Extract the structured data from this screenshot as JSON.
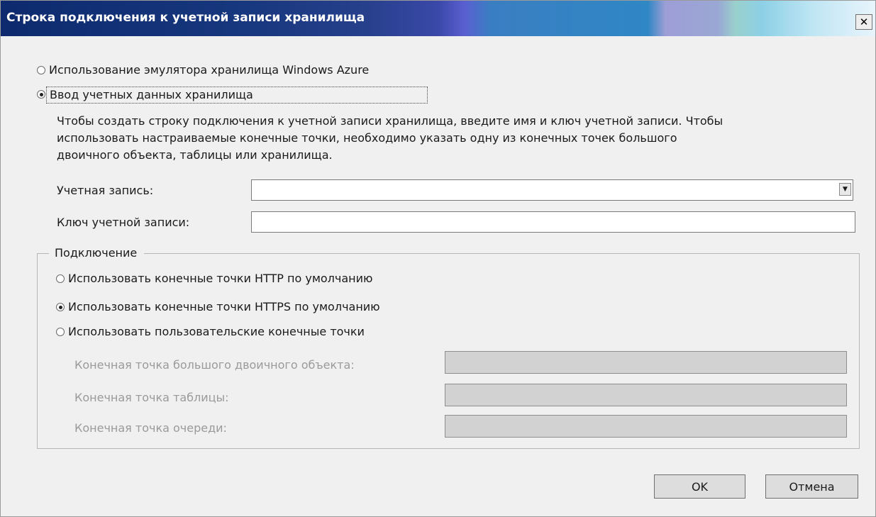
{
  "window": {
    "title": "Строка подключения к учетной записи хранилища",
    "close_glyph": "✕"
  },
  "storage_mode": {
    "emulator_label": "Использование эмулятора хранилища Windows Azure",
    "credentials_label": "Ввод учетных данных хранилища",
    "selected": "credentials"
  },
  "description": [
    "Чтобы создать строку подключения к учетной записи хранилища, введите имя и ключ учетной записи.  Чтобы",
    "использовать настраиваемые конечные точки, необходимо указать одну из конечных точек большого",
    "двоичного объекта, таблицы или хранилища."
  ],
  "account": {
    "name_label": "Учетная запись:",
    "name_value": "",
    "key_label": "Ключ учетной записи:",
    "key_value": "",
    "dropdown_glyph": "▼"
  },
  "connection": {
    "group_label": "Подключение",
    "http_label": "Использовать конечные точки HTTP по умолчанию",
    "https_label": "Использовать конечные точки HTTPS по умолчанию",
    "custom_label": "Использовать пользовательские конечные точки",
    "selected": "https",
    "blob_endpoint_label": "Конечная точка большого двоичного объекта:",
    "table_endpoint_label": "Конечная точка таблицы:",
    "queue_endpoint_label": "Конечная точка очереди:"
  },
  "buttons": {
    "ok": "OK",
    "cancel": "Отмена"
  }
}
